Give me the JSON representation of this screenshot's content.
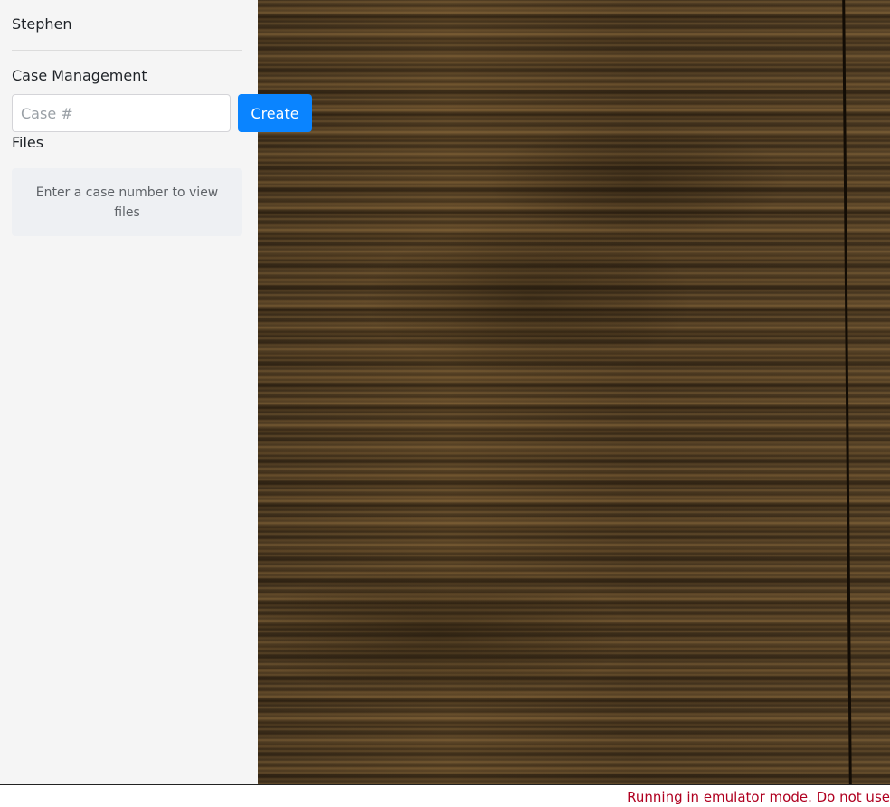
{
  "user": {
    "name": "Stephen"
  },
  "case_management": {
    "title": "Case Management",
    "input_placeholder": "Case #",
    "input_value": "",
    "create_label": "Create"
  },
  "files": {
    "title": "Files",
    "empty_message": "Enter a case number to view files"
  },
  "status_bar": {
    "warning": "Running in emulator mode. Do not use"
  },
  "colors": {
    "sidebar_bg": "#f5f5f5",
    "accent": "#0a84ff",
    "warning_text": "#b00020"
  }
}
